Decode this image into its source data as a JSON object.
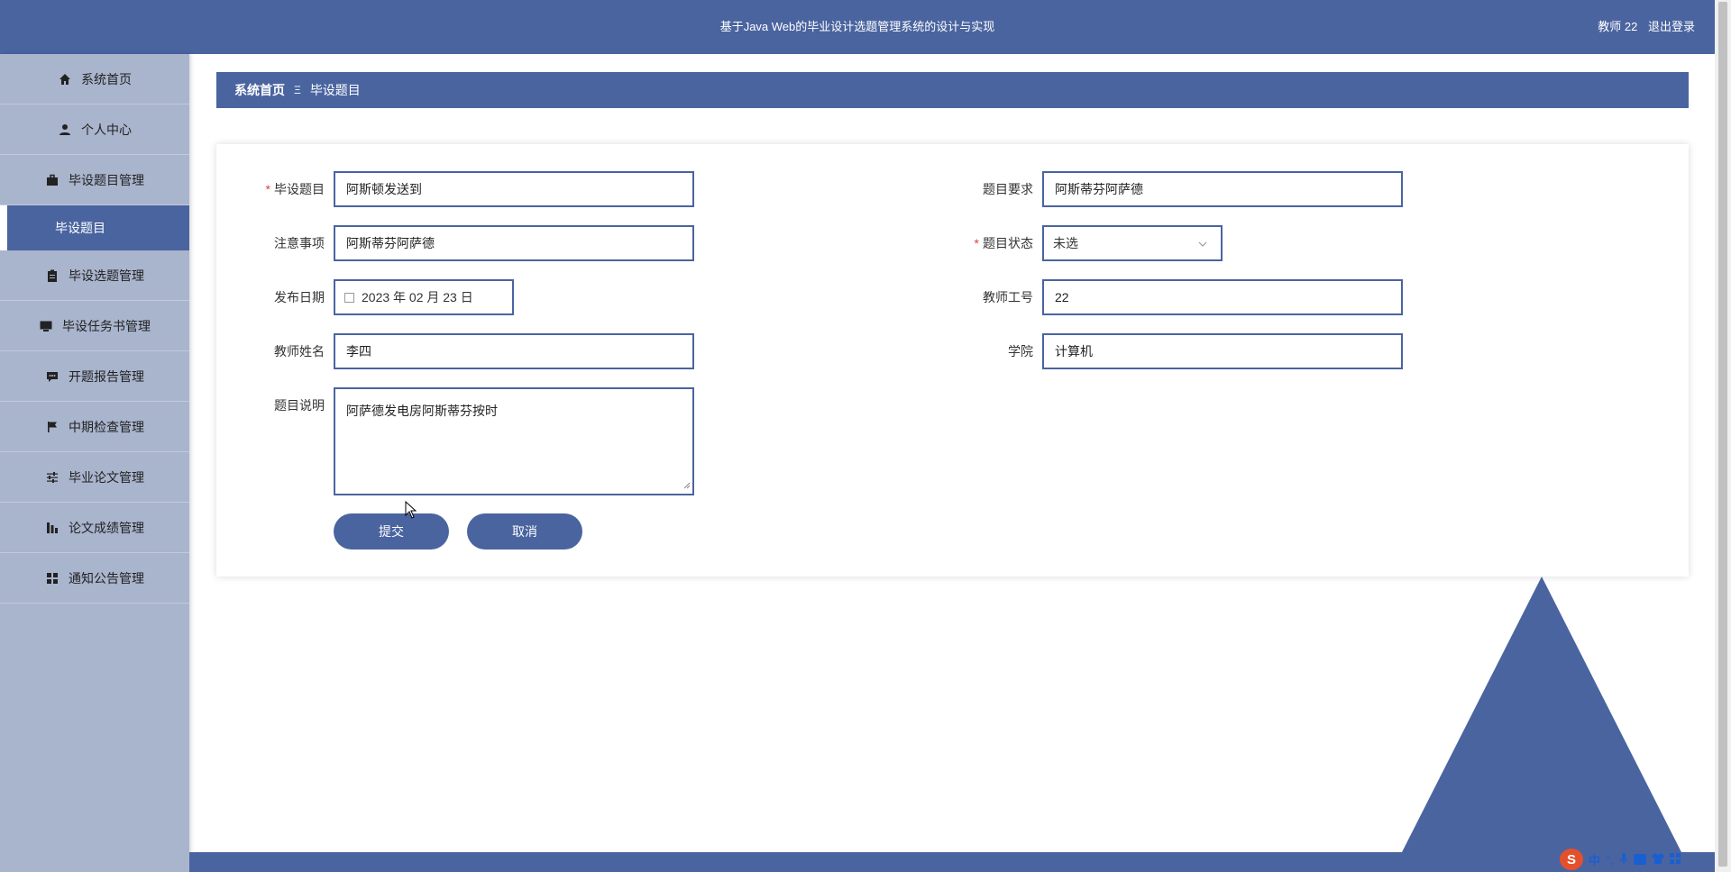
{
  "header": {
    "title": "基于Java Web的毕业设计选题管理系统的设计与实现",
    "user": "教师 22",
    "logout": "退出登录"
  },
  "sidebar": {
    "items": [
      {
        "label": "系统首页",
        "icon": "home-icon"
      },
      {
        "label": "个人中心",
        "icon": "user-icon"
      },
      {
        "label": "毕设题目管理",
        "icon": "briefcase-icon"
      },
      {
        "label": "毕设选题管理",
        "icon": "clipboard-icon"
      },
      {
        "label": "毕设任务书管理",
        "icon": "monitor-icon"
      },
      {
        "label": "开题报告管理",
        "icon": "comment-icon"
      },
      {
        "label": "中期检查管理",
        "icon": "flag-icon"
      },
      {
        "label": "毕业论文管理",
        "icon": "sliders-icon"
      },
      {
        "label": "论文成绩管理",
        "icon": "chart-icon"
      },
      {
        "label": "通知公告管理",
        "icon": "grid-icon"
      }
    ],
    "active_sub": "毕设题目"
  },
  "breadcrumb": {
    "home": "系统首页",
    "separator": "Ξ",
    "current": "毕设题目"
  },
  "form": {
    "topic_label": "毕设题目",
    "topic_value": "阿斯顿发送到",
    "requirement_label": "题目要求",
    "requirement_value": "阿斯蒂芬阿萨德",
    "notes_label": "注意事项",
    "notes_value": "阿斯蒂芬阿萨德",
    "status_label": "题目状态",
    "status_value": "未选",
    "date_label": "发布日期",
    "date_value": "2023 年 02 月 23 日",
    "teacher_id_label": "教师工号",
    "teacher_id_value": "22",
    "teacher_name_label": "教师姓名",
    "teacher_name_value": "李四",
    "college_label": "学院",
    "college_value": "计算机",
    "desc_label": "题目说明",
    "desc_value": "阿萨德发电房阿斯蒂芬按时",
    "required_mark": "*",
    "submit_label": "提交",
    "cancel_label": "取消"
  },
  "ime": {
    "logo": "S",
    "mode": "中",
    "punct": "°,"
  },
  "colors": {
    "primary": "#4a64a0",
    "sidebar_bg": "#a9b4cd",
    "required": "#e04040"
  }
}
